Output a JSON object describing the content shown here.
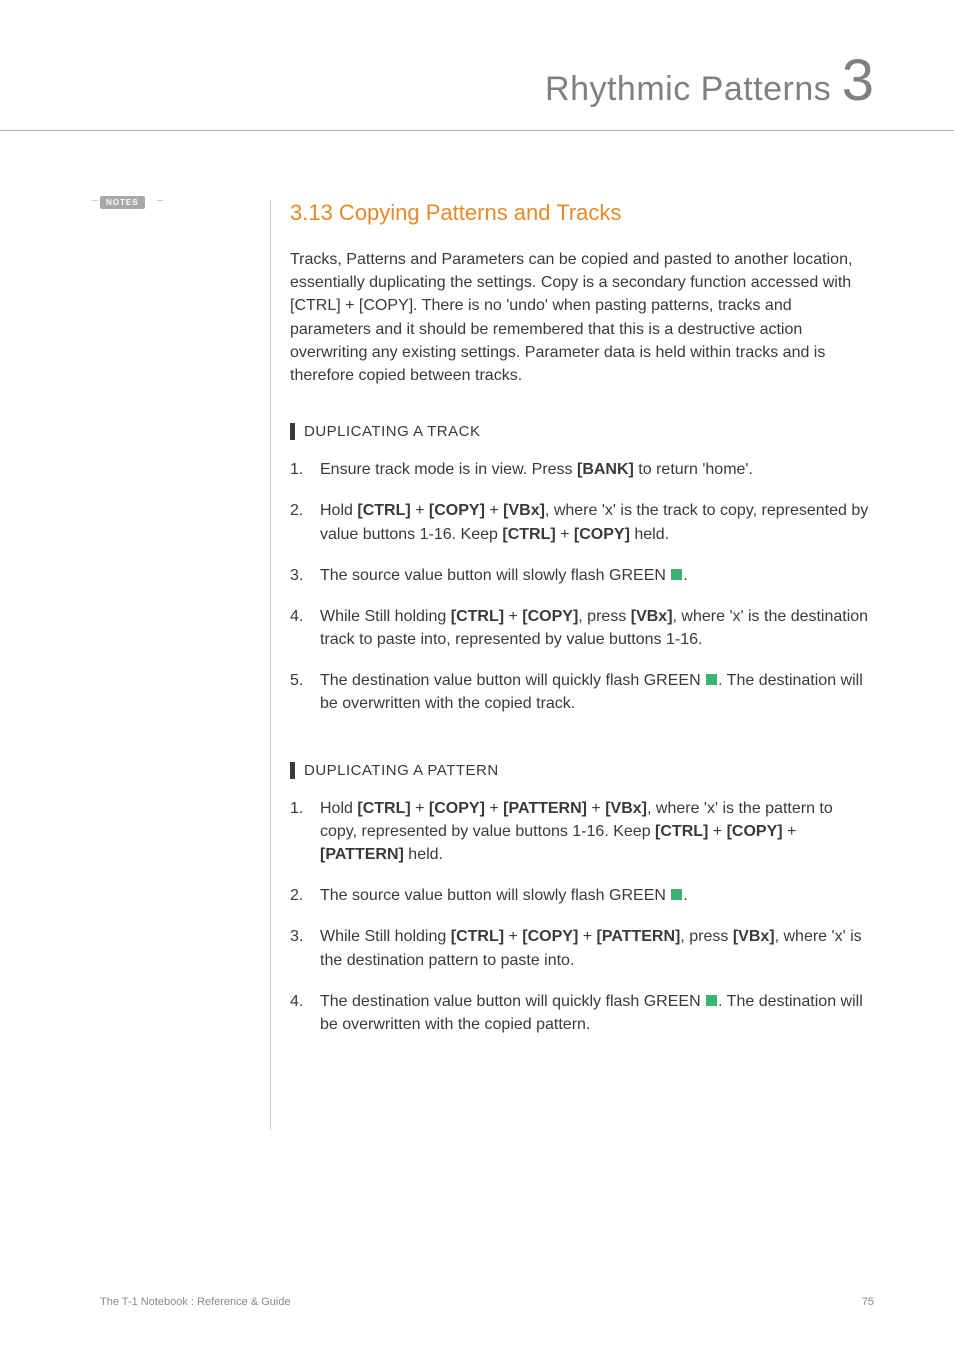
{
  "header": {
    "title": "Rhythmic Patterns",
    "chapter_num": "3"
  },
  "notes_label": "NOTES",
  "section": {
    "title": "3.13 Copying Patterns and Tracks",
    "intro": "Tracks, Patterns and Parameters can be copied and pasted to another location, essentially duplicating the settings. Copy is a secondary function accessed with [CTRL] + [COPY]. There is no 'undo' when pasting patterns, tracks and parameters and it should be remembered that this is a destructive action overwriting any existing settings. Parameter data is held within tracks and is therefore copied between tracks."
  },
  "block1": {
    "heading": "DUPLICATING A TRACK",
    "steps": {
      "s1_a": "Ensure track mode is in view. Press ",
      "s1_b": "[BANK]",
      "s1_c": " to return 'home'.",
      "s2_a": "Hold ",
      "s2_b": "[CTRL]",
      "s2_c": " + ",
      "s2_d": "[COPY]",
      "s2_e": " + ",
      "s2_f": "[VBx]",
      "s2_g": ", where 'x' is the track to copy, represented by value buttons 1-16. Keep ",
      "s2_h": "[CTRL]",
      "s2_i": " + ",
      "s2_j": "[COPY]",
      "s2_k": " held.",
      "s3_a": "The source value button will slowly flash GREEN ",
      "s3_b": ".",
      "s4_a": "While Still holding ",
      "s4_b": "[CTRL]",
      "s4_c": " + ",
      "s4_d": "[COPY]",
      "s4_e": ", press ",
      "s4_f": "[VBx]",
      "s4_g": ", where 'x' is the destination track to paste into, represented by value buttons 1-16.",
      "s5_a": "The destination value button will quickly flash GREEN ",
      "s5_b": ". The destination will be overwritten with the copied track."
    }
  },
  "block2": {
    "heading": "DUPLICATING A PATTERN",
    "steps": {
      "s1_a": "Hold ",
      "s1_b": "[CTRL]",
      "s1_c": " + ",
      "s1_d": "[COPY]",
      "s1_e": " + ",
      "s1_f": "[PATTERN]",
      "s1_g": " +  ",
      "s1_h": "[VBx]",
      "s1_i": ", where 'x' is the pattern to copy, represented by value buttons 1-16. Keep ",
      "s1_j": "[CTRL]",
      "s1_k": " + ",
      "s1_l": "[COPY]",
      "s1_m": " + ",
      "s1_n": "[PATTERN]",
      "s1_o": " held.",
      "s2_a": "The source value button will slowly flash GREEN ",
      "s2_b": ".",
      "s3_a": "While Still holding ",
      "s3_b": "[CTRL]",
      "s3_c": " + ",
      "s3_d": "[COPY]",
      "s3_e": " + ",
      "s3_f": "[PATTERN]",
      "s3_g": ", press ",
      "s3_h": "[VBx]",
      "s3_i": ", where 'x' is the destination pattern to paste into.",
      "s4_a": "The destination value button will quickly flash GREEN ",
      "s4_b": ". The destination will be overwritten with the copied pattern."
    }
  },
  "footer": {
    "left": "The T-1 Notebook : Reference & Guide",
    "page": "75"
  }
}
